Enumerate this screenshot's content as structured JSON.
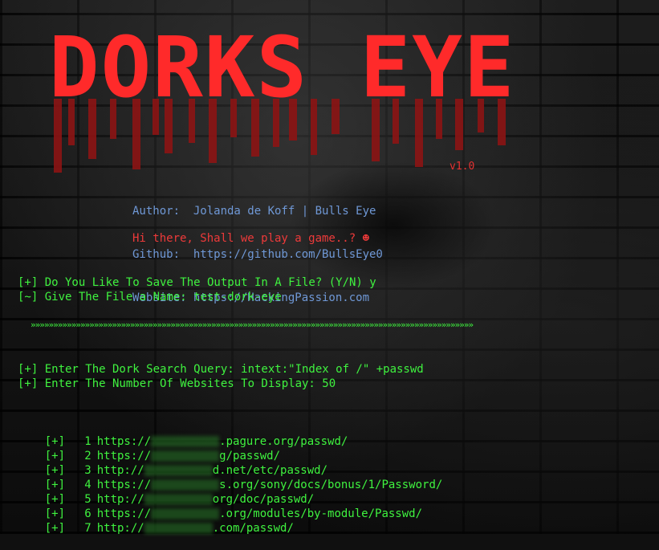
{
  "banner": {
    "title": "DORKS EYE",
    "version": "v1.0"
  },
  "info": {
    "author": "Author:  Jolanda de Koff | Bulls Eye",
    "github": "Github:  https://github.com/BullsEye0",
    "website": "Website: https://HackingPassion.com",
    "greeting": "Hi there, Shall we play a game..? ☻"
  },
  "prompts": {
    "save_output": "[+] Do You Like To Save The Output In A File? (Y/N) y",
    "file_name": "[~] Give The File a Name: test-dork-eye",
    "divider": "»»»»»»»»»»»»»»»»»»»»»»»»»»»»»»»»»»»»»»»»»»»»»»»»»»»»»»»»»»»»»»»»»»»»»»»»»»»»»»»»»»»»»»»»»»»»»»»»»»",
    "search_query": "[+] Enter The Dork Search Query: intext:\"Index of /\" +passwd",
    "num_websites": "[+] Enter The Number Of Websites To Display: 50"
  },
  "results": [
    {
      "mark": "[+]",
      "num": "1",
      "prefix": "https://",
      "suffix": ".pagure.org/passwd/"
    },
    {
      "mark": "[+]",
      "num": "2",
      "prefix": "https://",
      "suffix": "g/passwd/"
    },
    {
      "mark": "[+]",
      "num": "3",
      "prefix": "http://",
      "suffix": "d.net/etc/passwd/"
    },
    {
      "mark": "[+]",
      "num": "4",
      "prefix": "https://",
      "suffix": "s.org/sony/docs/bonus/1/Password/"
    },
    {
      "mark": "[+]",
      "num": "5",
      "prefix": "http://",
      "suffix": "org/doc/passwd/"
    },
    {
      "mark": "[+]",
      "num": "6",
      "prefix": "https://",
      "suffix": ".org/modules/by-module/Passwd/"
    },
    {
      "mark": "[+]",
      "num": "7",
      "prefix": "http://",
      "suffix": ".com/passwd/"
    }
  ]
}
